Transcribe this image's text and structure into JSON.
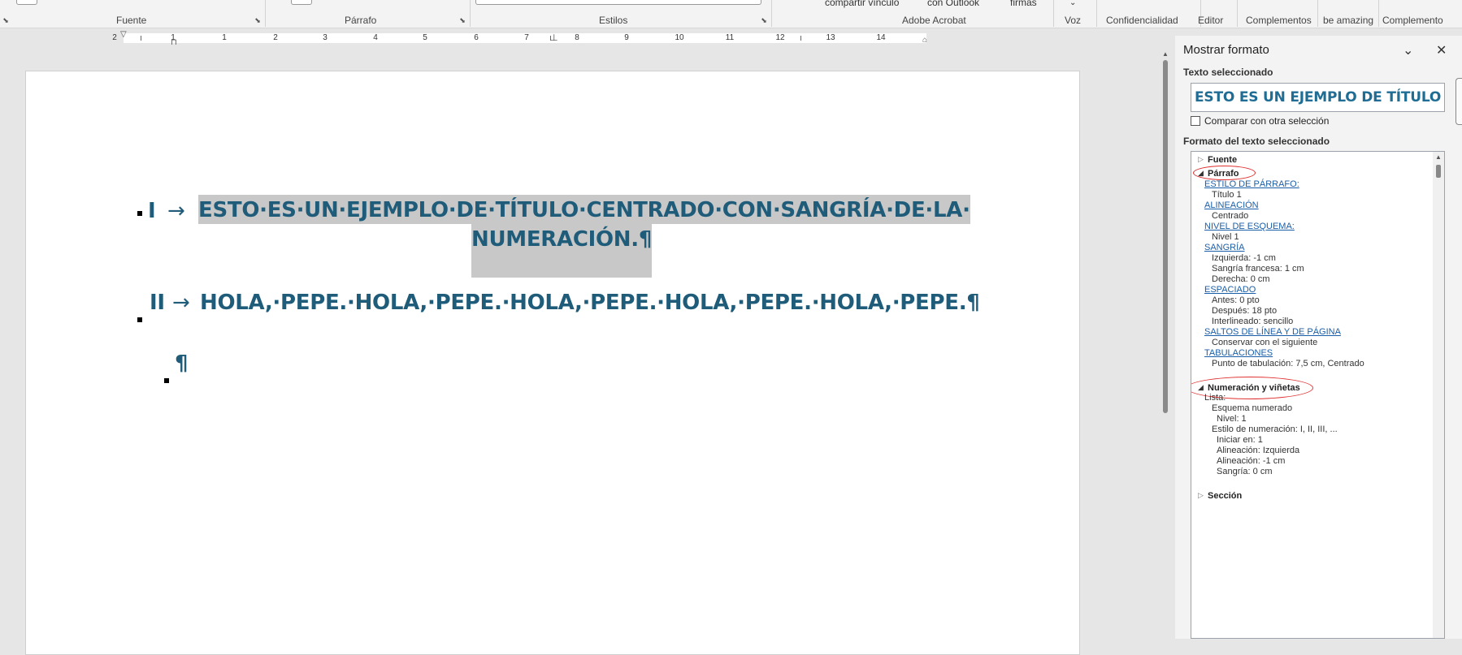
{
  "ribbon": {
    "groups": [
      "Fuente",
      "Párrafo",
      "Estilos",
      "Adobe Acrobat",
      "Voz",
      "Confidencialidad",
      "Editor",
      "Complementos",
      "be amazing",
      "Complemento"
    ],
    "partial_buttons": [
      "compartir vínculo",
      "con Outlook",
      "firmas"
    ]
  },
  "ruler": {
    "numbers": [
      "2",
      "1",
      "1",
      "2",
      "3",
      "4",
      "5",
      "6",
      "7",
      "8",
      "9",
      "10",
      "11",
      "12",
      "13",
      "14"
    ]
  },
  "document": {
    "line1_num": "I",
    "arrow": "→",
    "line1_text": "ESTO·ES·UN·EJEMPLO·DE·TÍTULO·CENTRADO·CON·SANGRÍA·DE·LA·",
    "line1_cont": "NUMERACIÓN.¶",
    "line2_num": "II",
    "line2_text": "HOLA,·PEPE.·HOLA,·PEPE.·HOLA,·PEPE.·HOLA,·PEPE.·HOLA,·PEPE.¶",
    "line3_text": "¶"
  },
  "pane": {
    "title": "Mostrar formato",
    "selected_label": "Texto seleccionado",
    "sample": "ESTO ES UN EJEMPLO DE TÍTULO CENTRADO",
    "compare_label": "Comparar con otra selección",
    "format_label": "Formato del texto seleccionado",
    "fuente": "Fuente",
    "parrafo": "Párrafo",
    "estilo_link": "ESTILO DE PÁRRAFO:",
    "estilo_val": "Título 1",
    "alineacion_link": "ALINEACIÓN",
    "alineacion_val": "Centrado",
    "esquema_link": "NIVEL DE ESQUEMA:",
    "esquema_val": "Nivel 1",
    "sangria_link": "SANGRÍA",
    "sangria_izq": "Izquierda:  -1 cm",
    "sangria_fr": "Sangría francesa:  1 cm",
    "sangria_der": "Derecha:  0 cm",
    "espaciado_link": "ESPACIADO",
    "esp_antes": "Antes:  0 pto",
    "esp_despues": "Después:  18 pto",
    "esp_inter": "Interlineado:  sencillo",
    "saltos_link": "SALTOS DE LÍNEA Y DE PÁGINA",
    "saltos_val": "Conservar con el siguiente",
    "tab_link": "TABULACIONES",
    "tab_val": "Punto de tabulación:  7,5 cm, Centrado",
    "numeracion": "Numeración y viñetas",
    "lista": "Lista:",
    "esquema_num": "Esquema numerado",
    "nivel": "Nivel: 1",
    "estilo_num": "Estilo de numeración:   I, II, III, ...",
    "iniciar": "Iniciar en: 1",
    "alin_izq": "Alineación: Izquierda",
    "alin_cm": "Alineación:  -1 cm",
    "sangria2": "Sangría:  0 cm",
    "seccion": "Sección"
  },
  "colors": {
    "heading_text": "#1f5c7a",
    "selection": "#c8c8c8",
    "link": "#1a5ea8",
    "annotation_circle": "#e03030"
  }
}
